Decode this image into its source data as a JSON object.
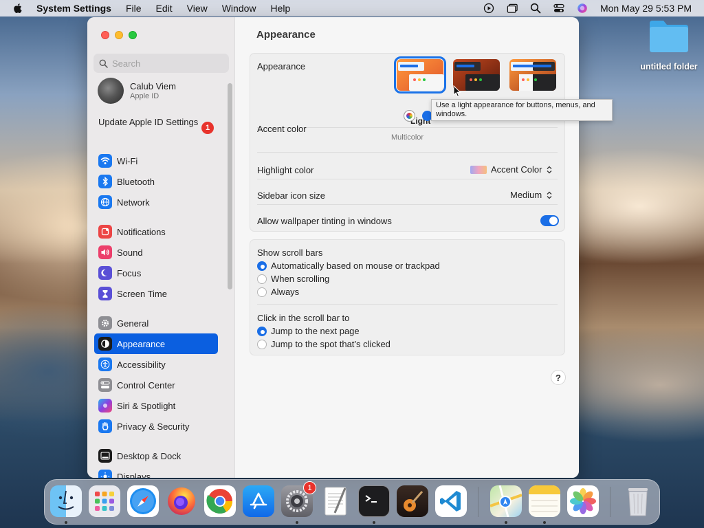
{
  "menubar": {
    "app": "System Settings",
    "menus": [
      "File",
      "Edit",
      "View",
      "Window",
      "Help"
    ],
    "clock": "Mon May 29  5:53 PM"
  },
  "desktop": {
    "folder_label": "untitled folder"
  },
  "sidebar": {
    "search_placeholder": "Search",
    "profile": {
      "name": "Calub Viem",
      "subtitle": "Apple ID"
    },
    "update": {
      "label": "Update Apple ID Settings",
      "badge": "1"
    },
    "items": [
      {
        "label": "Wi-Fi"
      },
      {
        "label": "Bluetooth"
      },
      {
        "label": "Network"
      },
      {
        "label": "Notifications"
      },
      {
        "label": "Sound"
      },
      {
        "label": "Focus"
      },
      {
        "label": "Screen Time"
      },
      {
        "label": "General"
      },
      {
        "label": "Appearance"
      },
      {
        "label": "Accessibility"
      },
      {
        "label": "Control Center"
      },
      {
        "label": "Siri & Spotlight"
      },
      {
        "label": "Privacy & Security"
      },
      {
        "label": "Desktop & Dock"
      },
      {
        "label": "Displays"
      }
    ]
  },
  "content": {
    "title": "Appearance",
    "appearance": {
      "label": "Appearance",
      "selected_label": "Light",
      "tooltip": "Use a light appearance for buttons, menus, and windows."
    },
    "accent": {
      "label": "Accent color",
      "caption": "Multicolor",
      "colors": [
        "#1a6ee6",
        "#8b3fa8",
        "#e8458f",
        "#e0383a",
        "#f08522",
        "#f5c324",
        "#5cb848",
        "#8c8c8c"
      ]
    },
    "highlight": {
      "label": "Highlight color",
      "value": "Accent Color"
    },
    "sidebar_icon_size": {
      "label": "Sidebar icon size",
      "value": "Medium"
    },
    "wallpaper_tinting": {
      "label": "Allow wallpaper tinting in windows",
      "on": true
    },
    "scroll_bars": {
      "label": "Show scroll bars",
      "options": [
        "Automatically based on mouse or trackpad",
        "When scrolling",
        "Always"
      ],
      "selected": 0
    },
    "click_scroll": {
      "label": "Click in the scroll bar to",
      "options": [
        "Jump to the next page",
        "Jump to the spot that’s clicked"
      ],
      "selected": 0
    },
    "help": "?"
  },
  "dock": {
    "system_settings_badge": "1"
  }
}
